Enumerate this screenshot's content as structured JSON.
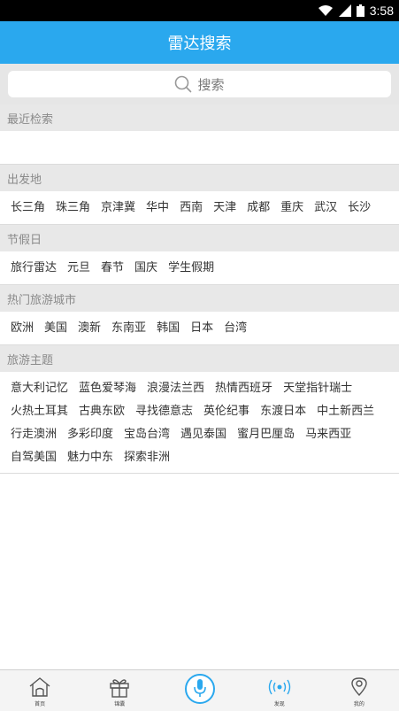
{
  "status_bar": {
    "time": "3:58"
  },
  "header": {
    "title": "雷达搜索"
  },
  "search": {
    "label": "搜索"
  },
  "sections": {
    "recent": {
      "title": "最近检索"
    },
    "departure": {
      "title": "出发地",
      "items": [
        "长三角",
        "珠三角",
        "京津冀",
        "华中",
        "西南",
        "天津",
        "成都",
        "重庆",
        "武汉",
        "长沙"
      ]
    },
    "holiday": {
      "title": "节假日",
      "items": [
        "旅行雷达",
        "元旦",
        "春节",
        "国庆",
        "学生假期"
      ]
    },
    "hot_cities": {
      "title": "热门旅游城市",
      "items": [
        "欧洲",
        "美国",
        "澳新",
        "东南亚",
        "韩国",
        "日本",
        "台湾"
      ]
    },
    "themes": {
      "title": "旅游主题",
      "items": [
        "意大利记忆",
        "蓝色爱琴海",
        "浪漫法兰西",
        "热情西班牙",
        "天堂指针瑞士",
        "火热土耳其",
        "古典东欧",
        "寻找德意志",
        "英伦纪事",
        "东渡日本",
        "中土新西兰",
        "行走澳洲",
        "多彩印度",
        "宝岛台湾",
        "遇见泰国",
        "蜜月巴厘岛",
        "马来西亚",
        "自驾美国",
        "魅力中东",
        "探索非洲"
      ]
    }
  },
  "tabs": {
    "home": "首页",
    "deals": "锦囊",
    "discover": "发现",
    "mine": "我的"
  },
  "colors": {
    "accent": "#2aa8ee"
  }
}
